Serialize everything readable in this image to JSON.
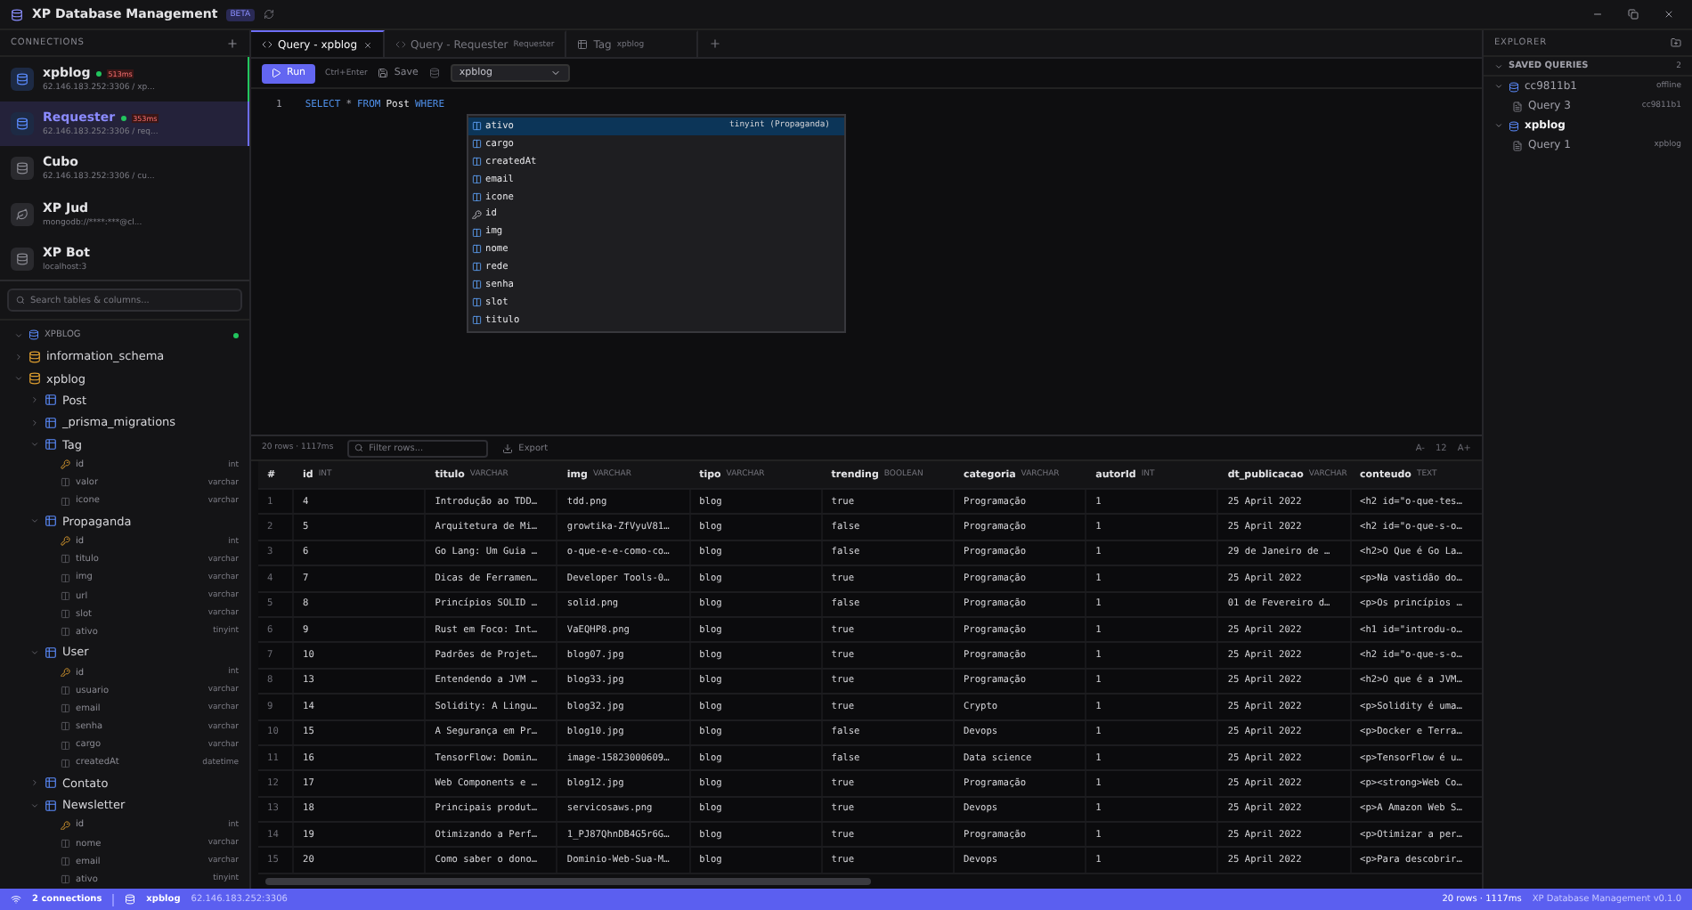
{
  "window": {
    "title": "XP Database Management",
    "badge": "BETA"
  },
  "connections_panel": {
    "title": "CONNECTIONS",
    "items": [
      {
        "name": "xpblog",
        "address": "62.146.183.252:3306 / xp...",
        "kind": "sql",
        "connected": true,
        "latency": "513ms",
        "selected": false,
        "active": true
      },
      {
        "name": "Requester",
        "address": "62.146.183.252:3306 / req...",
        "kind": "sql",
        "connected": true,
        "latency": "353ms",
        "selected": true,
        "active": false
      },
      {
        "name": "Cubo",
        "address": "62.146.183.252:3306 / cu...",
        "kind": "sql",
        "connected": false,
        "selected": false,
        "active": false
      },
      {
        "name": "XP Jud",
        "address": "mongodb://****:***@cl...",
        "kind": "mongo",
        "connected": false,
        "selected": false,
        "active": false
      },
      {
        "name": "XP Bot",
        "address": "localhost:3",
        "kind": "sql",
        "connected": false,
        "selected": false,
        "active": false
      }
    ]
  },
  "schema_search": {
    "placeholder": "Search tables & columns..."
  },
  "schema_tree": {
    "connection": "XPBLOG",
    "connected": true,
    "children": [
      {
        "kind": "schema",
        "label": "information_schema",
        "expanded": false
      },
      {
        "kind": "schema",
        "label": "xpblog",
        "expanded": true,
        "children": [
          {
            "kind": "table",
            "label": "Post",
            "expanded": false
          },
          {
            "kind": "table",
            "label": "_prisma_migrations",
            "expanded": false
          },
          {
            "kind": "table",
            "label": "Tag",
            "expanded": true,
            "children": [
              {
                "kind": "key",
                "label": "id",
                "type": "int"
              },
              {
                "kind": "column",
                "label": "valor",
                "type": "varchar"
              },
              {
                "kind": "column",
                "label": "icone",
                "type": "varchar"
              }
            ]
          },
          {
            "kind": "table",
            "label": "Propaganda",
            "expanded": true,
            "children": [
              {
                "kind": "key",
                "label": "id",
                "type": "int"
              },
              {
                "kind": "column",
                "label": "titulo",
                "type": "varchar"
              },
              {
                "kind": "column",
                "label": "img",
                "type": "varchar"
              },
              {
                "kind": "column",
                "label": "url",
                "type": "varchar"
              },
              {
                "kind": "column",
                "label": "slot",
                "type": "varchar"
              },
              {
                "kind": "column",
                "label": "ativo",
                "type": "tinyint"
              }
            ]
          },
          {
            "kind": "table",
            "label": "User",
            "expanded": true,
            "children": [
              {
                "kind": "key",
                "label": "id",
                "type": "int"
              },
              {
                "kind": "column",
                "label": "usuario",
                "type": "varchar"
              },
              {
                "kind": "column",
                "label": "email",
                "type": "varchar"
              },
              {
                "kind": "column",
                "label": "senha",
                "type": "varchar"
              },
              {
                "kind": "column",
                "label": "cargo",
                "type": "varchar"
              },
              {
                "kind": "column",
                "label": "createdAt",
                "type": "datetime"
              }
            ]
          },
          {
            "kind": "table",
            "label": "Contato",
            "expanded": false
          },
          {
            "kind": "table",
            "label": "Newsletter",
            "expanded": true,
            "children": [
              {
                "kind": "key",
                "label": "id",
                "type": "int"
              },
              {
                "kind": "column",
                "label": "nome",
                "type": "varchar"
              },
              {
                "kind": "column",
                "label": "email",
                "type": "varchar"
              },
              {
                "kind": "column",
                "label": "ativo",
                "type": "tinyint"
              }
            ]
          }
        ]
      }
    ]
  },
  "tabs": [
    {
      "label": "Query - xpblog",
      "kind": "query",
      "selected": true,
      "closable": true
    },
    {
      "label": "Query - Requester",
      "sub": "Requester",
      "kind": "query",
      "selected": false,
      "closable": false
    },
    {
      "label": "Tag",
      "sub": "xpblog",
      "kind": "table",
      "selected": false,
      "closable": false
    }
  ],
  "toolbar": {
    "run": "Run",
    "shortcut": "Ctrl+Enter",
    "save": "Save",
    "database": "xpblog"
  },
  "editor": {
    "lines": [
      {
        "number": "1",
        "tokens": [
          {
            "text": "SELECT",
            "kind": "keyword"
          },
          {
            "text": "*",
            "kind": "operator"
          },
          {
            "text": "FROM",
            "kind": "keyword"
          },
          {
            "text": "Post",
            "kind": "ident"
          },
          {
            "text": "WHERE",
            "kind": "keyword"
          }
        ]
      }
    ],
    "suggestions": [
      {
        "label": "ativo",
        "kind": "column",
        "detail": "tinyint (Propaganda)",
        "selected": true
      },
      {
        "label": "cargo",
        "kind": "column",
        "selected": false
      },
      {
        "label": "createdAt",
        "kind": "column",
        "selected": false
      },
      {
        "label": "email",
        "kind": "column",
        "selected": false
      },
      {
        "label": "icone",
        "kind": "column",
        "selected": false
      },
      {
        "label": "id",
        "kind": "key",
        "selected": false
      },
      {
        "label": "img",
        "kind": "column",
        "selected": false
      },
      {
        "label": "nome",
        "kind": "column",
        "selected": false
      },
      {
        "label": "rede",
        "kind": "column",
        "selected": false
      },
      {
        "label": "senha",
        "kind": "column",
        "selected": false
      },
      {
        "label": "slot",
        "kind": "column",
        "selected": false
      },
      {
        "label": "titulo",
        "kind": "column",
        "selected": false
      }
    ]
  },
  "results": {
    "summary": "20 rows · 1117ms",
    "filter_placeholder": "Filter rows...",
    "export": "Export",
    "font_decrease": "A-",
    "font_size": "12",
    "font_increase": "A+",
    "columns": [
      {
        "name": "#"
      },
      {
        "name": "id",
        "type": "INT"
      },
      {
        "name": "titulo",
        "type": "VARCHAR"
      },
      {
        "name": "img",
        "type": "VARCHAR"
      },
      {
        "name": "tipo",
        "type": "VARCHAR"
      },
      {
        "name": "trending",
        "type": "BOOLEAN"
      },
      {
        "name": "categoria",
        "type": "VARCHAR"
      },
      {
        "name": "autorId",
        "type": "INT"
      },
      {
        "name": "dt_publicacao",
        "type": "VARCHAR"
      },
      {
        "name": "conteudo",
        "type": "TEXT"
      }
    ],
    "rows": [
      [
        "1",
        "4",
        "Introdução ao TDD…",
        "tdd.png",
        "blog",
        "true",
        "Programação",
        "1",
        "25 April 2022",
        "<h2 id=\"o-que-tes…"
      ],
      [
        "2",
        "5",
        "Arquitetura de Mi…",
        "growtika-ZfVyuV81…",
        "blog",
        "false",
        "Programação",
        "1",
        "25 April 2022",
        "<h2 id=\"o-que-s-o…"
      ],
      [
        "3",
        "6",
        "Go Lang: Um Guia …",
        "o-que-e-e-como-co…",
        "blog",
        "false",
        "Programação",
        "1",
        "29 de Janeiro de …",
        "<h2>O Que é Go La…"
      ],
      [
        "4",
        "7",
        "Dicas de Ferramen…",
        "Developer Tools-0…",
        "blog",
        "true",
        "Programação",
        "1",
        "25 April 2022",
        "<p>Na vastidão do…"
      ],
      [
        "5",
        "8",
        "Princípios SOLID …",
        "solid.png",
        "blog",
        "false",
        "Programação",
        "1",
        "01 de Fevereiro d…",
        "<p>Os princípios …"
      ],
      [
        "6",
        "9",
        "Rust em Foco: Int…",
        "VaEQHP8.png",
        "blog",
        "true",
        "Programação",
        "1",
        "25 April 2022",
        "<h1 id=\"introdu-o…"
      ],
      [
        "7",
        "10",
        "Padrões de Projet…",
        "blog07.jpg",
        "blog",
        "true",
        "Programação",
        "1",
        "25 April 2022",
        "<h2 id=\"o-que-s-o…"
      ],
      [
        "8",
        "13",
        "Entendendo a JVM …",
        "blog33.jpg",
        "blog",
        "true",
        "Programação",
        "1",
        "25 April 2022",
        "<h2>O que é a JVM…"
      ],
      [
        "9",
        "14",
        "Solidity: A Lingu…",
        "blog32.jpg",
        "blog",
        "true",
        "Crypto",
        "1",
        "25 April 2022",
        "<p>Solidity é uma…"
      ],
      [
        "10",
        "15",
        "A Segurança em Pr…",
        "blog10.jpg",
        "blog",
        "false",
        "Devops",
        "1",
        "25 April 2022",
        "<p>Docker e Terra…"
      ],
      [
        "11",
        "16",
        "TensorFlow: Domin…",
        "image-15823000609…",
        "blog",
        "false",
        "Data science",
        "1",
        "25 April 2022",
        "<p>TensorFlow é u…"
      ],
      [
        "12",
        "17",
        "Web Components e …",
        "blog12.jpg",
        "blog",
        "true",
        "Programação",
        "1",
        "25 April 2022",
        "<p><strong>Web Co…"
      ],
      [
        "13",
        "18",
        "Principais produt…",
        "servicosaws.png",
        "blog",
        "true",
        "Devops",
        "1",
        "25 April 2022",
        "<p>A Amazon Web S…"
      ],
      [
        "14",
        "19",
        "Otimizando a Perf…",
        "1_PJ87QhnDB4G5r6G…",
        "blog",
        "true",
        "Programação",
        "1",
        "25 April 2022",
        "<p>Otimizar a per…"
      ],
      [
        "15",
        "20",
        "Como saber o dono…",
        "Dominio-Web-Sua-M…",
        "blog",
        "true",
        "Devops",
        "1",
        "25 April 2022",
        "<p>Para descobrir…"
      ]
    ]
  },
  "explorer": {
    "title": "EXPLORER",
    "section": "SAVED QUERIES",
    "count": "2",
    "groups": [
      {
        "name": "cc9811b1",
        "status": "offline",
        "bold": false,
        "expanded": true,
        "queries": [
          {
            "name": "Query 3",
            "meta": "cc9811b1"
          }
        ]
      },
      {
        "name": "xpblog",
        "bold": true,
        "expanded": true,
        "queries": [
          {
            "name": "Query 1",
            "meta": "xpblog"
          }
        ]
      }
    ]
  },
  "status_bar": {
    "connections": "2 connections",
    "database": "xpblog",
    "address": "62.146.183.252:3306",
    "summary": "20 rows · 1117ms",
    "version": "XP Database Management v0.1.0"
  }
}
